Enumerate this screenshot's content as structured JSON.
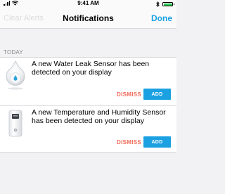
{
  "status_bar": {
    "time": "9:41 AM",
    "battery_color": "#34c759",
    "icons": [
      "signal-icon",
      "wifi-icon",
      "bluetooth-icon",
      "battery-icon"
    ]
  },
  "nav": {
    "left_label": "Clear Alerts",
    "title": "Notifications",
    "right_label": "Done",
    "accent_color": "#1ba1e2"
  },
  "section": {
    "header": "TODAY"
  },
  "notifications": [
    {
      "icon": "water-leak-sensor-icon",
      "message": "A new Water Leak Sensor has been detected on your display",
      "dismiss_label": "DISMISS",
      "add_label": "ADD"
    },
    {
      "icon": "temperature-humidity-sensor-icon",
      "message": "A new Temperature and Humidity Sensor has been detected on your display",
      "dismiss_label": "DISMISS",
      "add_label": "ADD"
    }
  ],
  "colors": {
    "dismiss": "#f26b5b",
    "add": "#1ba1e2",
    "background": "#f2f2f4"
  }
}
